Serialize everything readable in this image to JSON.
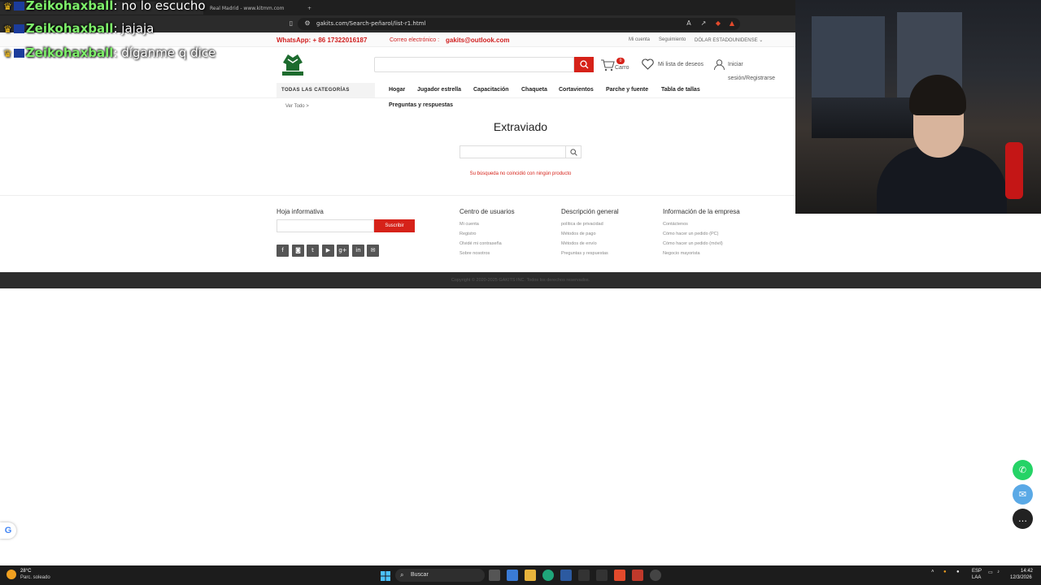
{
  "browser": {
    "tab_active": "",
    "tab_other": "Real Madrid - www.kitmm.com",
    "tab_new": "+",
    "url": "gakits.com/Search-peñarol/list-r1.html"
  },
  "chat": [
    {
      "user": "Zeikohaxball",
      "message": ": no lo escucho"
    },
    {
      "user": "Zeikohaxball",
      "message": ": jajaja"
    },
    {
      "user": "Zeikohaxball",
      "message": ": díganme q dice"
    }
  ],
  "site": {
    "whatsapp": "WhatsApp: + 86 17322016187",
    "email_label": "Correo electrónico :",
    "email": "gakits@outlook.com",
    "top_links": [
      "Mi cuenta",
      "Seguimiento",
      "DÓLAR ESTADOUNIDENSE ⌄"
    ],
    "logo_text": "GAKITS",
    "search_value": "",
    "cart_count": "0",
    "cart_label": "Carro",
    "wishlist_label": "Mi lista de deseos",
    "login_label": "Iniciar",
    "register_label": "sesión/Registrarse"
  },
  "nav": {
    "all_categories": "TODAS LAS CATEGORÍAS",
    "see_all": "Ver Todo >",
    "items": [
      "Hogar",
      "Jugador estrella",
      "Capacitación",
      "Chaqueta",
      "Cortavientos",
      "Parche y fuente",
      "Tabla de tallas",
      "Preguntas y respuestas"
    ]
  },
  "content": {
    "title": "Extraviado",
    "search_value": "",
    "message": "Su búsqueda no coincidió con ningún producto"
  },
  "footer": {
    "newsletter_title": "Hoja informativa",
    "subscribe_label": "Suscribir",
    "social": [
      "f",
      "◙",
      "t",
      "▶",
      "g+",
      "in",
      "✉"
    ],
    "columns": [
      {
        "title": "Centro de usuarios",
        "links": [
          "Mi cuenta",
          "Registro",
          "Olvidé mi contraseña",
          "Sobre nosotros"
        ]
      },
      {
        "title": "Descripción general",
        "links": [
          "política de privacidad",
          "Métodos de pago",
          "Métodos de envío",
          "Preguntas y respuestas"
        ]
      },
      {
        "title": "Información de la empresa",
        "links": [
          "Contáctenos",
          "Cómo hacer un pedido (PC)",
          "Cómo hacer un pedido (móvil)",
          "Negocio mayorista"
        ]
      }
    ],
    "copyright": "Copyright © 2020-2025 GAKITS INC. Todos los derechos reservados."
  },
  "taskbar": {
    "temperature": "28°C",
    "weather": "Parc. soleado",
    "search_label": "Buscar",
    "language": "ESP",
    "language_sub": "LAA",
    "time": "14:42",
    "date": "12/3/2026"
  },
  "colors": {
    "accent_red": "#d62219",
    "whatsapp_green": "#25d366",
    "email_blue": "#5aa9e6"
  }
}
